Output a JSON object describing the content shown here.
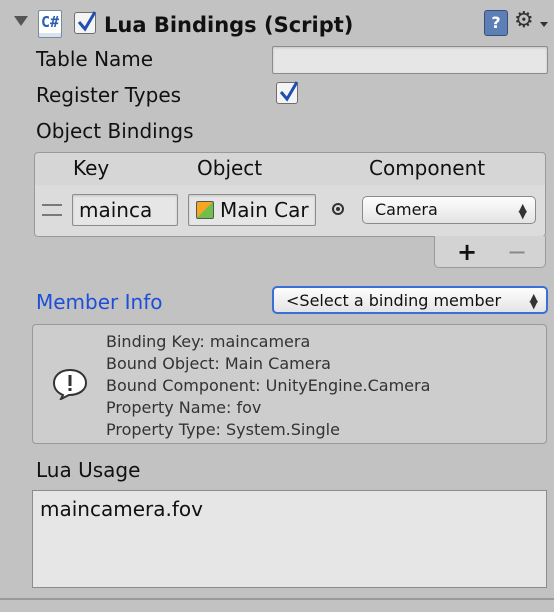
{
  "header": {
    "script_icon_text": "C#",
    "title": "Lua Bindings (Script)",
    "help_icon": "?",
    "gear_icon": "⚙"
  },
  "fields": {
    "table_name_label": "Table Name",
    "table_name_value": "",
    "register_types_label": "Register Types",
    "register_types_checked": true,
    "object_bindings_label": "Object Bindings"
  },
  "bindings": {
    "columns": [
      "Key",
      "Object",
      "Component"
    ],
    "rows": [
      {
        "key": "mainca",
        "object": "Main Car",
        "component": "Camera"
      }
    ],
    "add_label": "+",
    "remove_label": "−"
  },
  "member_info": {
    "label": "Member Info",
    "select_value": "<Select a binding member",
    "info_icon": "!",
    "lines": [
      "Binding Key: maincamera",
      "Bound Object: Main Camera",
      "Bound Component: UnityEngine.Camera",
      "Property Name: fov",
      "Property Type: System.Single"
    ]
  },
  "lua_usage": {
    "label": "Lua Usage",
    "text": "maincamera.fov"
  },
  "colors": {
    "background": "#c2c2c2",
    "member_info_blue": "#1d4ed8",
    "popup_focus_border": "#3b6fd8"
  }
}
